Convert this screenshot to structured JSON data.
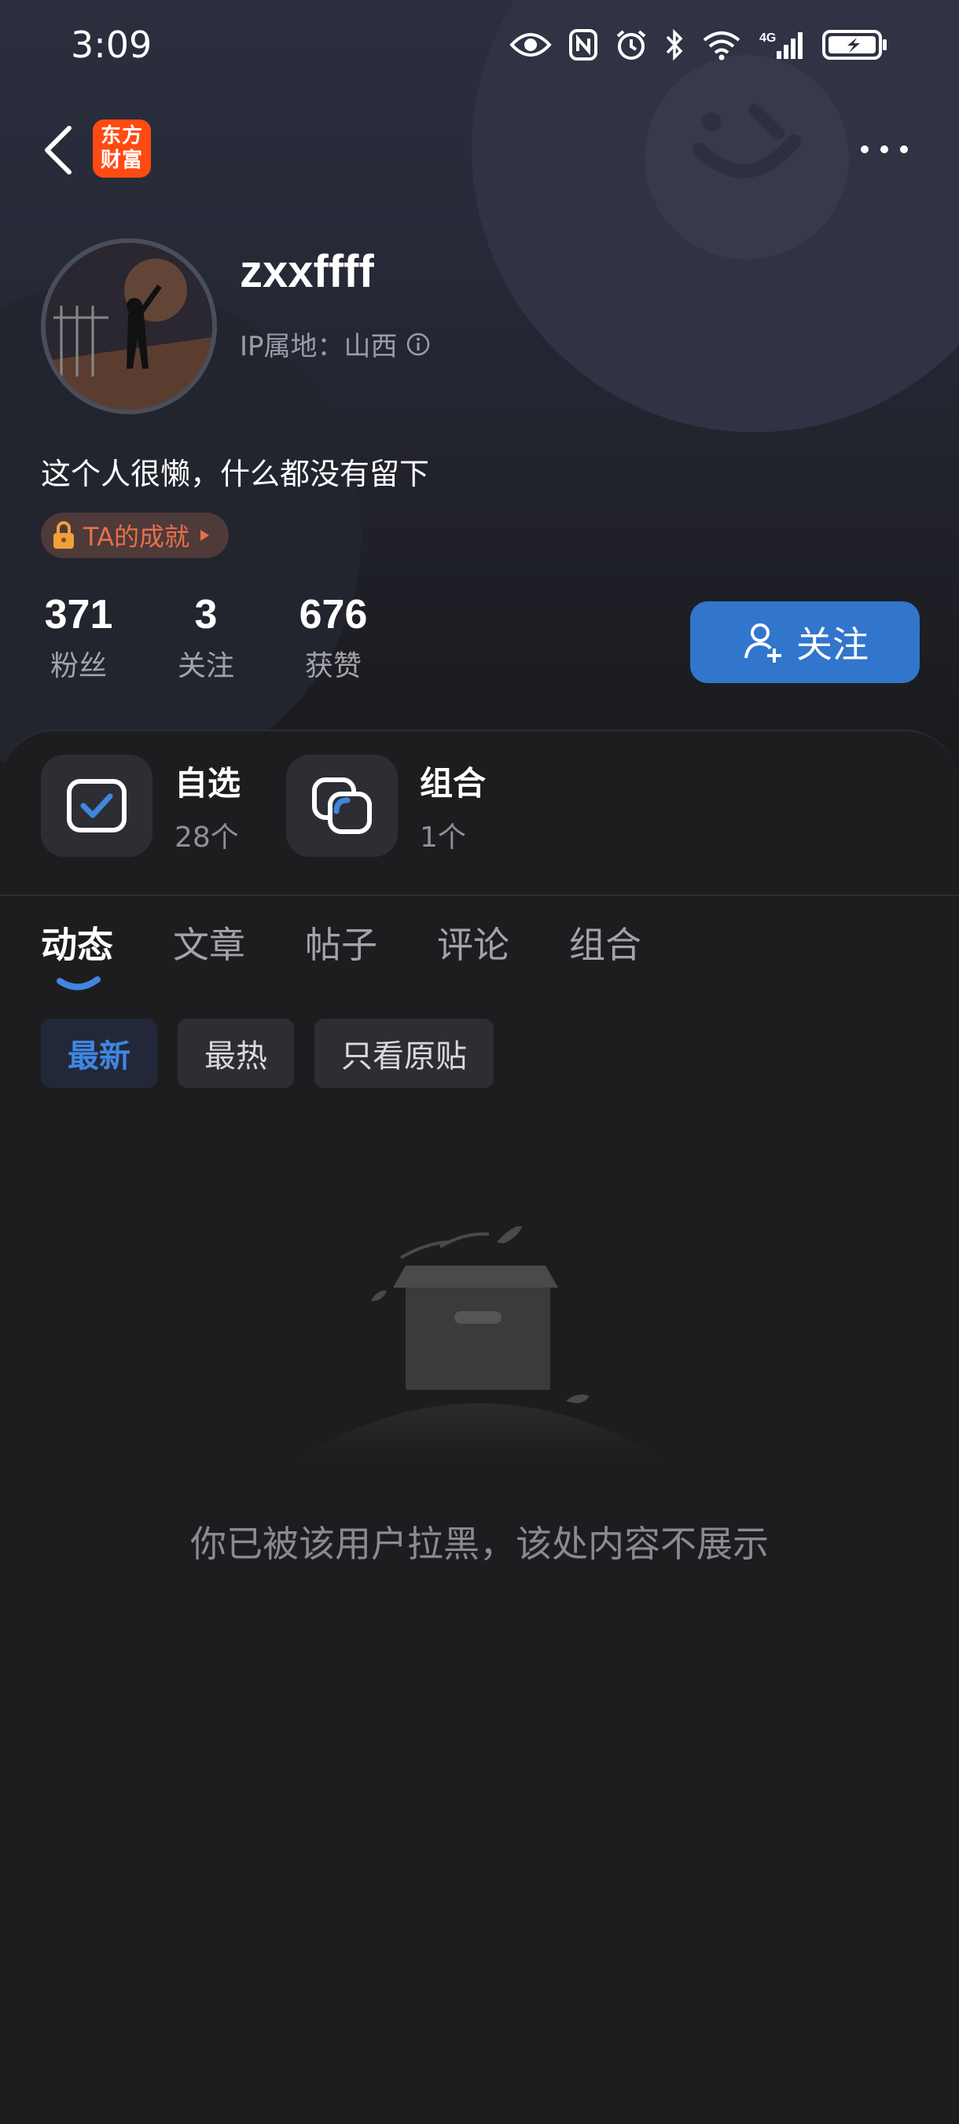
{
  "status_bar": {
    "time": "3:09",
    "icons": [
      "eye-icon",
      "nfc-icon",
      "alarm-icon",
      "bluetooth-icon",
      "wifi-icon",
      "signal-4g-icon",
      "battery-icon"
    ],
    "network_label": "4G"
  },
  "nav": {
    "app_logo_line1": "东方",
    "app_logo_line2": "财富",
    "brand_color": "#ff4a12"
  },
  "profile": {
    "username": "zxxffff",
    "ip_location": "IP属地：山西",
    "bio": "这个人很懒，什么都没有留下",
    "achievement_label": "TA的成就"
  },
  "stats": [
    {
      "value": "371",
      "label": "粉丝"
    },
    {
      "value": "3",
      "label": "关注"
    },
    {
      "value": "676",
      "label": "获赞"
    }
  ],
  "follow_button": {
    "label": "关注",
    "color": "#3176cc"
  },
  "quick_links": [
    {
      "title": "自选",
      "count": "28个"
    },
    {
      "title": "组合",
      "count": "1个"
    }
  ],
  "tabs": [
    "动态",
    "文章",
    "帖子",
    "评论",
    "组合"
  ],
  "active_tab": "动态",
  "filters": [
    "最新",
    "最热",
    "只看原贴"
  ],
  "active_filter": "最新",
  "empty_state": {
    "message": "你已被该用户拉黑，该处内容不展示"
  }
}
